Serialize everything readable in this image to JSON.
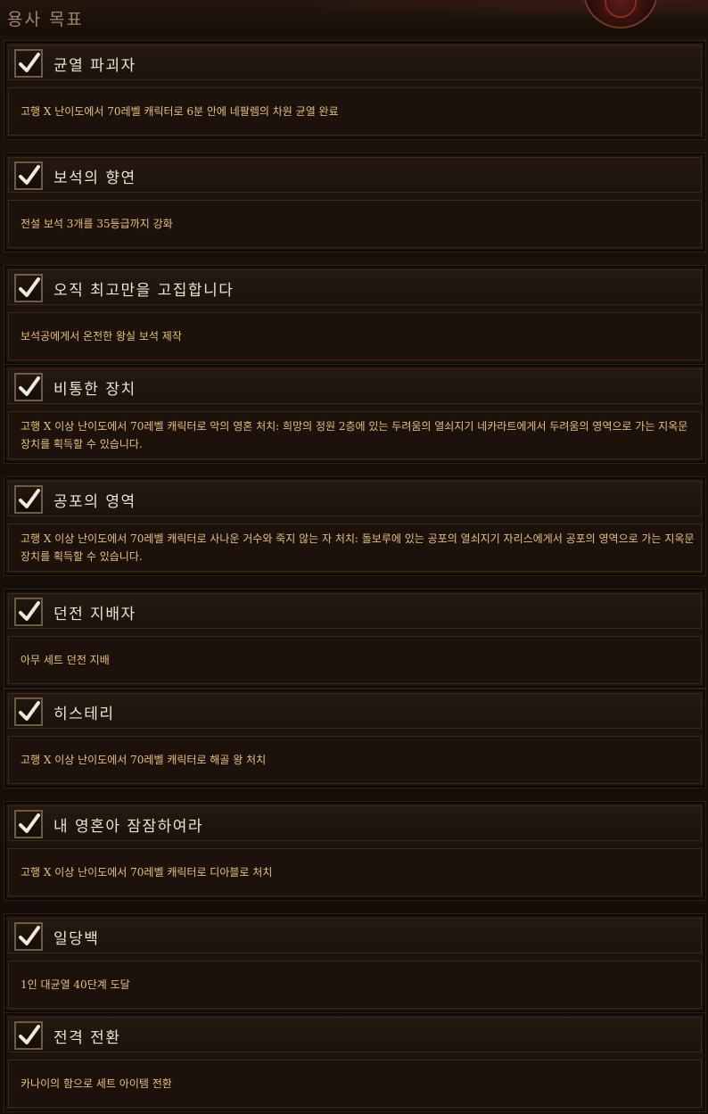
{
  "header": {
    "title": "용사 목표"
  },
  "achievements": [
    {
      "title": "균열 파괴자",
      "desc": "고행 X 난이도에서 70레벨 캐릭터로 6분 안에 네팔렘의 차원 균열 완료"
    },
    {
      "title": "보석의 향연",
      "desc": "전설 보석 3개를 35등급까지 강화"
    },
    {
      "title": "오직 최고만을 고집합니다",
      "desc": "보석공에게서 온전한 왕실 보석 제작"
    },
    {
      "title": "비통한 장치",
      "desc": "고행 X 이상 난이도에서 70레벨 캐릭터로 악의 영혼 처치: 희망의 정원 2층에 있는 두려움의 열쇠지기 네카라트에게서 두려움의 영역으로 가는 지옥문 장치를 획득할 수 있습니다."
    },
    {
      "title": "공포의 영역",
      "desc": "고행 X 이상 난이도에서 70레벨 캐릭터로 사나운 거수와 죽지 않는 자 처치: 돌보루에 있는 공포의 열쇠지기 자리스에게서 공포의 영역으로 가는 지옥문 장치를 획득할 수 있습니다."
    },
    {
      "title": "던전 지배자",
      "desc": "아무 세트 던전 지배"
    },
    {
      "title": "히스테리",
      "desc": "고행 X 이상 난이도에서 70레벨 캐릭터로 해골 왕 처치"
    },
    {
      "title": "내 영혼아 잠잠하여라",
      "desc": "고행 X 이상 난이도에서 70레벨 캐릭터로 디아블로 처치"
    },
    {
      "title": "일당백",
      "desc": "1인 대균열 40단계 도달"
    },
    {
      "title": "전격 전환",
      "desc": "카나이의 함으로 세트 아이템 전환"
    }
  ],
  "colors": {
    "title": "#ece2d2",
    "desc": "#e6c07a",
    "check": "#f2ead8",
    "checkbox_border": "#6f5b44"
  },
  "icons": {
    "check": "checkmark-icon",
    "emblem": "crest-emblem-icon"
  }
}
